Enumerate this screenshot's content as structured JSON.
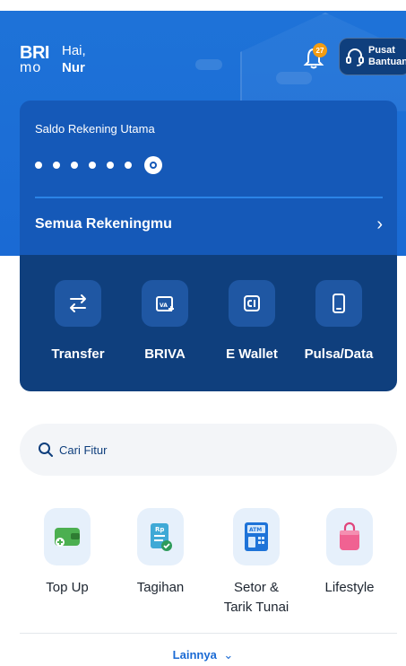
{
  "header": {
    "logo_top": "BRI",
    "logo_bottom": "mo",
    "greeting": "Hai,",
    "user_name": "Nur",
    "notification_count": "27",
    "help_line1": "Pusat",
    "help_line2": "Bantuan"
  },
  "balance": {
    "label": "Saldo Rekening Utama",
    "masked_dots": 6,
    "accounts_link": "Semua Rekeningmu"
  },
  "quick_actions": [
    {
      "label": "Transfer",
      "icon": "transfer-icon"
    },
    {
      "label": "BRIVA",
      "icon": "briva-icon"
    },
    {
      "label": "E Wallet",
      "icon": "ewallet-icon"
    },
    {
      "label": "Pulsa/Data",
      "icon": "phone-icon"
    }
  ],
  "search": {
    "placeholder": "Cari Fitur"
  },
  "menu": [
    {
      "label": "Top Up",
      "icon": "wallet-topup-icon"
    },
    {
      "label": "Tagihan",
      "icon": "bill-icon"
    },
    {
      "label": "Setor &\nTarik Tunai",
      "icon": "atm-icon"
    },
    {
      "label": "Lifestyle",
      "icon": "shopping-bag-icon"
    }
  ],
  "more_label": "Lainnya",
  "colors": {
    "primary": "#1a6ad4",
    "dark_blue": "#0f3f7d",
    "badge": "#f39c12"
  }
}
